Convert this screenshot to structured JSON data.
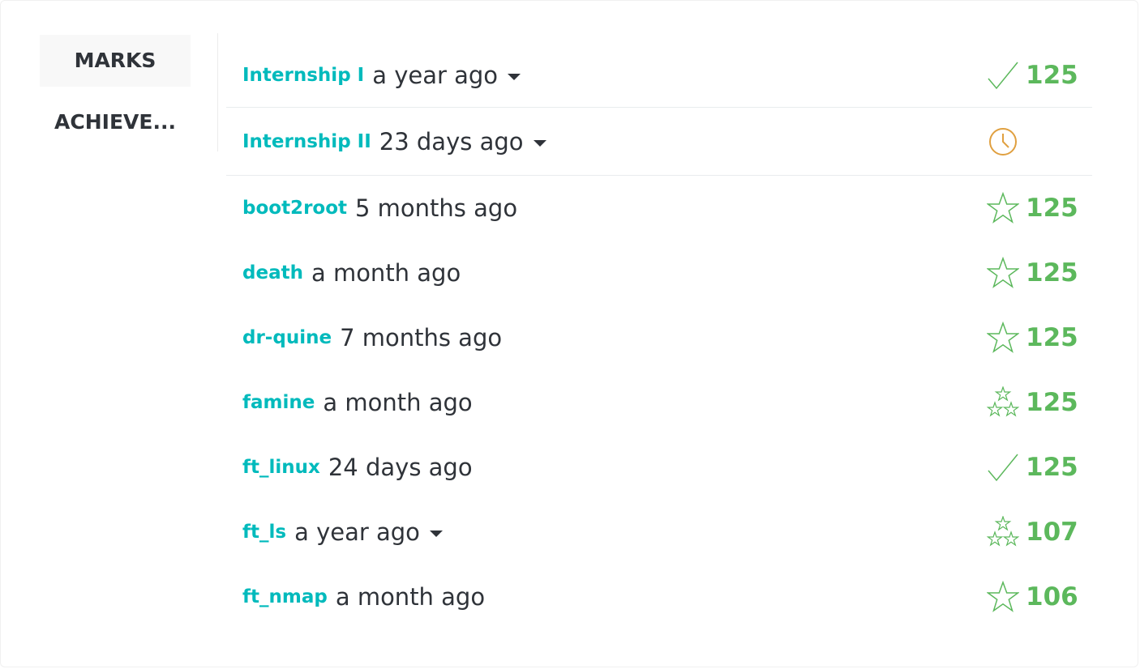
{
  "tabs": [
    {
      "label": "MARKS",
      "active": true
    },
    {
      "label": "ACHIEVE..."
    }
  ],
  "projects": [
    {
      "name": "Internship I",
      "when": "a year ago",
      "icon": "check-icon",
      "mark": "125",
      "dropdown": true
    },
    {
      "name": "Internship II",
      "when": "23 days ago",
      "icon": "clock-icon",
      "mark": "",
      "dropdown": true
    },
    {
      "name": "boot2root",
      "when": "5 months ago",
      "icon": "star-icon",
      "mark": "125"
    },
    {
      "name": "death",
      "when": "a month ago",
      "icon": "star-icon",
      "mark": "125"
    },
    {
      "name": "dr-quine",
      "when": "7 months ago",
      "icon": "star-icon",
      "mark": "125"
    },
    {
      "name": "famine",
      "when": "a month ago",
      "icon": "three-stars-icon",
      "mark": "125"
    },
    {
      "name": "ft_linux",
      "when": "24 days ago",
      "icon": "check-icon",
      "mark": "125"
    },
    {
      "name": "ft_ls",
      "when": "a year ago",
      "icon": "three-stars-icon",
      "mark": "107",
      "dropdown": true
    },
    {
      "name": "ft_nmap",
      "when": "a month ago",
      "icon": "star-icon",
      "mark": "106"
    }
  ],
  "colors": {
    "project": "#00babc",
    "mark": "#5cb85c",
    "pending": "#e0a040",
    "text": "#2f3339"
  }
}
